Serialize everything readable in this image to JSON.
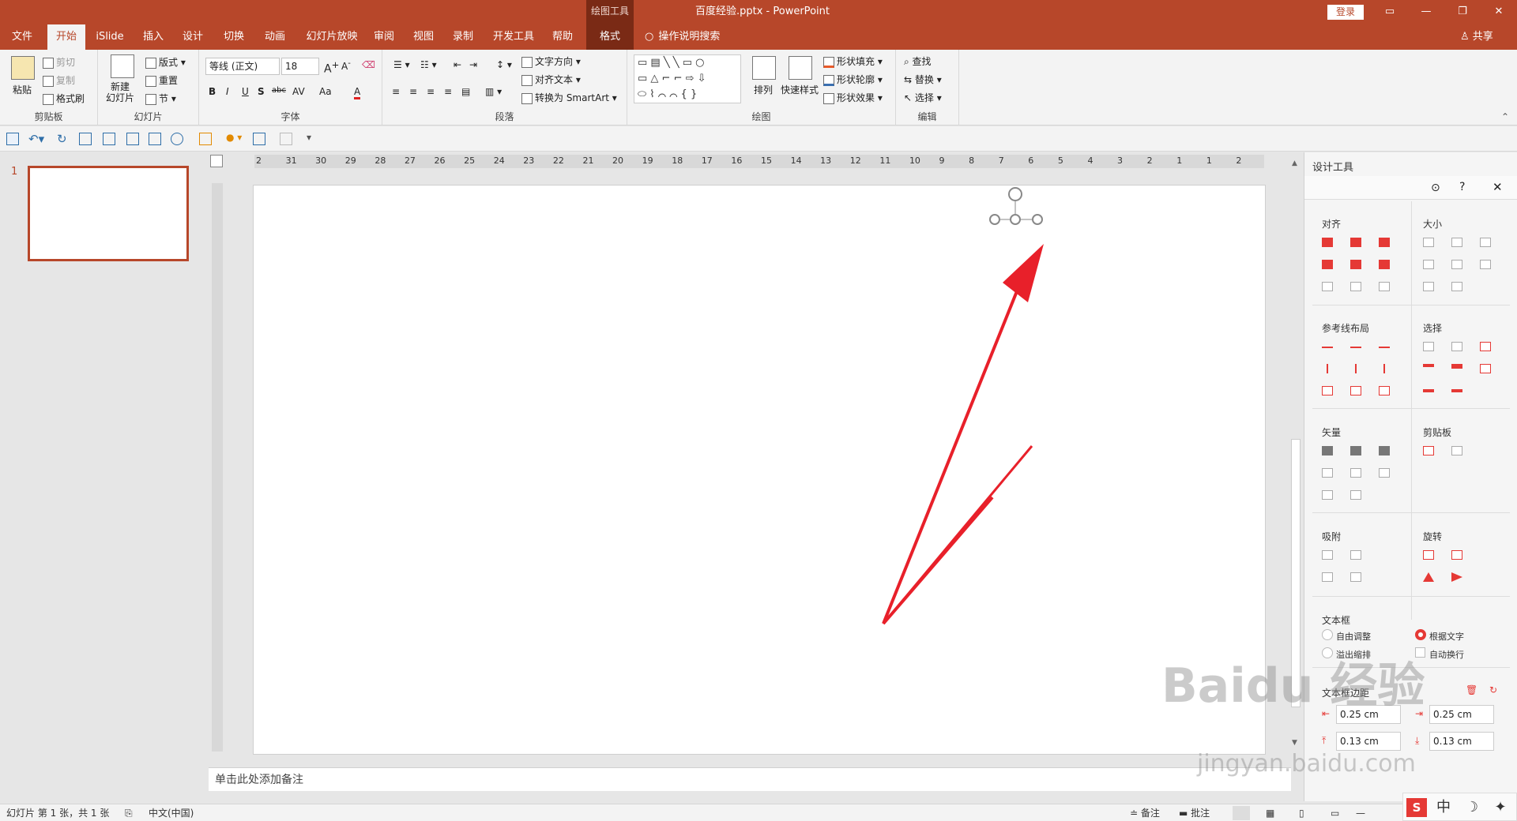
{
  "window": {
    "context_label": "绘图工具",
    "title": "百度经验.pptx  -  PowerPoint",
    "login": "登录",
    "controls": [
      "▭",
      "—",
      "❐",
      "✕"
    ]
  },
  "tabs": [
    "文件",
    "开始",
    "iSlide",
    "插入",
    "设计",
    "切换",
    "动画",
    "幻灯片放映",
    "审阅",
    "视图",
    "录制",
    "开发工具",
    "帮助",
    "格式"
  ],
  "search_tab": "操作说明搜索",
  "share": "共享",
  "ribbon": {
    "clipboard": {
      "label": "剪贴板",
      "paste": "粘贴",
      "cut": "剪切",
      "copy": "复制",
      "painter": "格式刷"
    },
    "slides": {
      "label": "幻灯片",
      "new_slide": "新建\n幻灯片",
      "layout": "版式",
      "reset": "重置",
      "section": "节"
    },
    "font": {
      "label": "字体",
      "font_name": "等线 (正文)",
      "font_size": "18",
      "buttons": [
        "B",
        "I",
        "U",
        "S",
        "abc",
        "AV",
        "Aa",
        "A"
      ]
    },
    "paragraph": {
      "label": "段落",
      "text_direction": "文字方向",
      "align_text": "对齐文本",
      "smartart": "转换为 SmartArt"
    },
    "drawing": {
      "label": "绘图",
      "arrange": "排列",
      "quick_styles": "快速样式",
      "fill": "形状填充",
      "outline": "形状轮廓",
      "effects": "形状效果"
    },
    "editing": {
      "label": "编辑",
      "find": "查找",
      "replace": "替换",
      "select": "选择"
    }
  },
  "ruler_numbers": [
    "2",
    "31",
    "30",
    "29",
    "28",
    "27",
    "26",
    "25",
    "24",
    "23",
    "22",
    "21",
    "20",
    "19",
    "18",
    "17",
    "16",
    "15",
    "14",
    "13",
    "12",
    "11",
    "10",
    "9",
    "8",
    "7",
    "6",
    "5",
    "4",
    "3",
    "2",
    "1",
    "1",
    "2"
  ],
  "slide_panel": {
    "number": "1"
  },
  "notes_placeholder": "单击此处添加备注",
  "design_panel": {
    "title": "设计工具",
    "sections": {
      "align": "对齐",
      "size": "大小",
      "guides": "参考线布局",
      "select": "选择",
      "vector": "矢量",
      "clipboard": "剪贴板",
      "snap": "吸附",
      "rotate": "旋转",
      "textbox": "文本框",
      "margins": "文本框边距"
    },
    "textbox_options": {
      "free": "自由调整",
      "fit": "根据文字",
      "overflow": "溢出缩排",
      "wrap": "自动换行"
    },
    "margins": {
      "left": "0.25 cm",
      "right": "0.25 cm",
      "top": "0.13 cm",
      "bottom": "0.13 cm"
    }
  },
  "status": {
    "slide_info": "幻灯片 第 1 张，共 1 张",
    "language": "中文(中国)",
    "notes": "备注",
    "comments": "批注"
  },
  "ime": {
    "keys": [
      "S",
      "中",
      "☽",
      "✦"
    ]
  },
  "watermark": {
    "main": "Baidu 经验",
    "sub": "jingyan.baidu.com"
  },
  "accent": "#b7472a",
  "arrow_color": "#e8202a"
}
